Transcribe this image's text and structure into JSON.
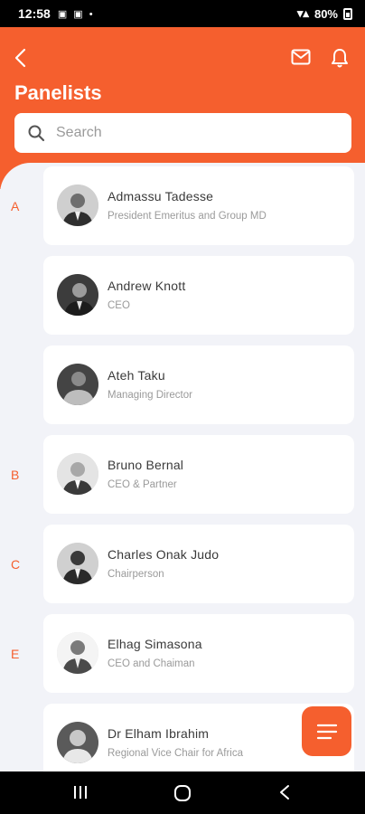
{
  "status_bar": {
    "time": "12:58",
    "battery": "80%"
  },
  "header": {
    "title": "Panelists"
  },
  "search": {
    "placeholder": "Search"
  },
  "panelists": [
    {
      "letter": "A",
      "name": "Admassu  Tadesse",
      "role": "President Emeritus and Group MD"
    },
    {
      "letter": "",
      "name": "Andrew  Knott",
      "role": "CEO"
    },
    {
      "letter": "",
      "name": "Ateh  Taku",
      "role": "Managing Director"
    },
    {
      "letter": "B",
      "name": "Bruno Bernal",
      "role": "CEO & Partner"
    },
    {
      "letter": "C",
      "name": "Charles  Onak Judo",
      "role": "Chairperson"
    },
    {
      "letter": "E",
      "name": "Elhag  Simasona",
      "role": "CEO and Chaiman"
    },
    {
      "letter": "",
      "name": "Dr Elham  Ibrahim",
      "role": "Regional Vice Chair for Africa"
    }
  ],
  "colors": {
    "accent": "#f55f2e",
    "background": "#f2f3f8",
    "card": "#ffffff"
  },
  "icons": {
    "back": "chevron-left-icon",
    "mail": "mail-icon",
    "bell": "bell-icon",
    "search": "search-icon",
    "fab": "menu-icon"
  }
}
